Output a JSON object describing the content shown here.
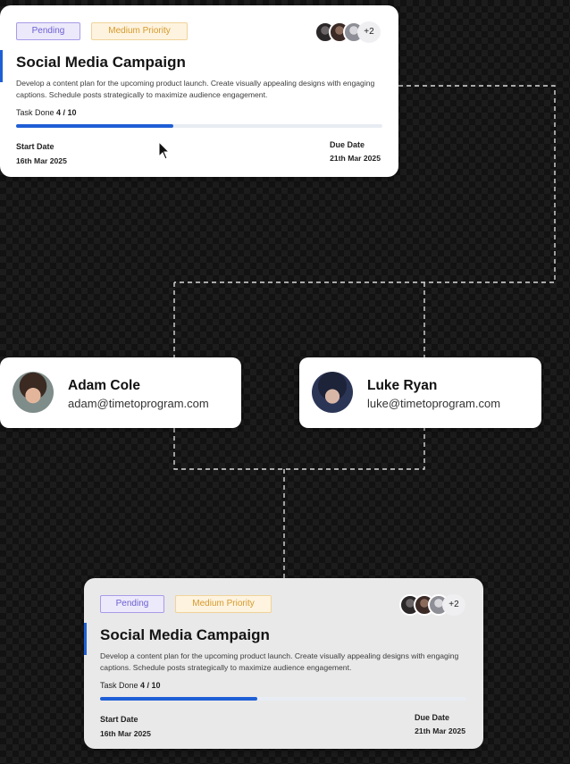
{
  "colors": {
    "accent_blue": "#1f5fd6",
    "status_pending_bg": "#ece9fb",
    "status_pending_border": "#a99be8",
    "status_pending_text": "#6b5fd0",
    "priority_medium_bg": "#fdf3df",
    "priority_medium_border": "#f1d39a",
    "priority_medium_text": "#d79a2b",
    "track": "#e8ecf3"
  },
  "task_top": {
    "status": "Pending",
    "priority": "Medium Priority",
    "extra_members": "+2",
    "title": "Social Media Campaign",
    "description": "Develop a content plan for the upcoming product launch. Create visually appealing designs with engaging captions. Schedule posts strategically to maximize audience engagement.",
    "progress_label": "Task Done",
    "progress_value": "4 / 10",
    "progress_fraction": 0.4,
    "start_label": "Start Date",
    "start_date": "16th Mar 2025",
    "due_label": "Due Date",
    "due_date": "21th Mar 2025"
  },
  "task_bottom": {
    "status": "Pending",
    "priority": "Medium Priority",
    "extra_members": "+2",
    "title": "Social Media Campaign",
    "description": "Develop a content plan for the upcoming product launch. Create visually appealing designs with engaging captions. Schedule posts strategically to maximize audience engagement.",
    "progress_label": "Task Done",
    "progress_value": "4 / 10",
    "progress_fraction": 0.4,
    "start_label": "Start Date",
    "start_date": "16th Mar 2025",
    "due_label": "Due Date",
    "due_date": "21th Mar 2025"
  },
  "people": [
    {
      "name": "Adam Cole",
      "email": "adam@timetoprogram.com"
    },
    {
      "name": "Luke Ryan",
      "email": "luke@timetoprogram.com"
    }
  ],
  "icons": {
    "member_avatars": "avatar-group",
    "cursor": "arrow-cursor-icon"
  }
}
